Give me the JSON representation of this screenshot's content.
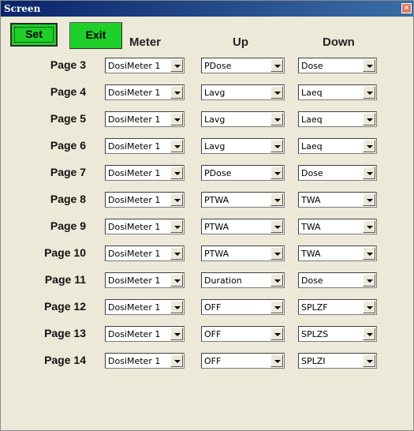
{
  "window": {
    "title": "Screen",
    "close_glyph": "×"
  },
  "buttons": {
    "set": "Set",
    "exit": "Exit"
  },
  "columns": {
    "meter": "Meter",
    "up": "Up",
    "down": "Down"
  },
  "rows": [
    {
      "page": "Page 3",
      "meter": "DosiMeter 1",
      "up": "PDose",
      "down": "Dose"
    },
    {
      "page": "Page 4",
      "meter": "DosiMeter 1",
      "up": "Lavg",
      "down": "Laeq"
    },
    {
      "page": "Page 5",
      "meter": "DosiMeter 1",
      "up": "Lavg",
      "down": "Laeq"
    },
    {
      "page": "Page 6",
      "meter": "DosiMeter 1",
      "up": "Lavg",
      "down": "Laeq"
    },
    {
      "page": "Page 7",
      "meter": "DosiMeter 1",
      "up": "PDose",
      "down": "Dose"
    },
    {
      "page": "Page 8",
      "meter": "DosiMeter 1",
      "up": "PTWA",
      "down": "TWA"
    },
    {
      "page": "Page 9",
      "meter": "DosiMeter 1",
      "up": "PTWA",
      "down": "TWA"
    },
    {
      "page": "Page 10",
      "meter": "DosiMeter 1",
      "up": "PTWA",
      "down": "TWA"
    },
    {
      "page": "Page 11",
      "meter": "DosiMeter 1",
      "up": "Duration",
      "down": "Dose"
    },
    {
      "page": "Page 12",
      "meter": "DosiMeter 1",
      "up": "OFF",
      "down": "SPLZF"
    },
    {
      "page": "Page 13",
      "meter": "DosiMeter 1",
      "up": "OFF",
      "down": "SPLZS"
    },
    {
      "page": "Page 14",
      "meter": "DosiMeter 1",
      "up": "OFF",
      "down": "SPLZI"
    }
  ],
  "colors": {
    "button_green": "#1fcf2a",
    "titlebar": "#0a246a",
    "background": "#ece9d8"
  }
}
